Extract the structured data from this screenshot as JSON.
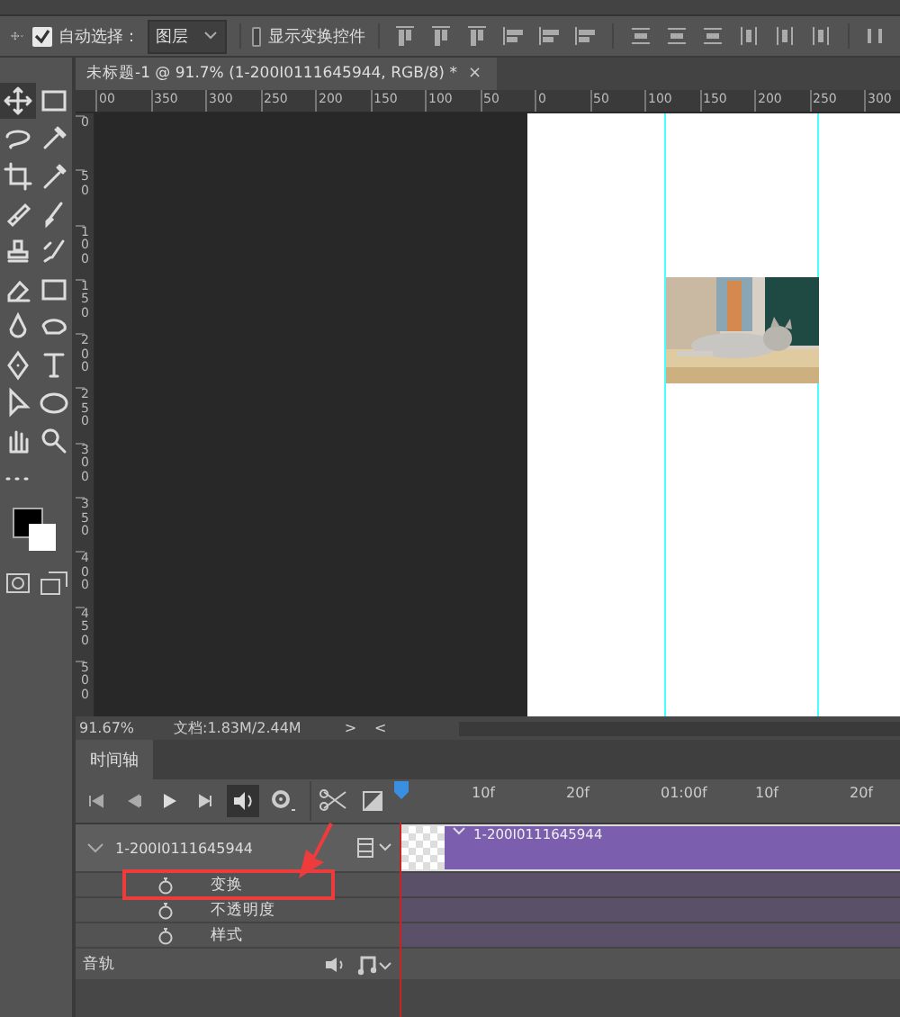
{
  "options_bar": {
    "auto_select": {
      "label": "自动选择：",
      "checked": true
    },
    "target_dropdown": {
      "value": "图层"
    },
    "show_transform_controls": {
      "label": "显示变换控件",
      "checked": false
    }
  },
  "document_tab": {
    "title": "未标题-1 @ 91.7% (1-200I0111645944, RGB/8) *",
    "close": "×"
  },
  "horizontal_ruler": [
    "00",
    "350",
    "300",
    "250",
    "200",
    "150",
    "100",
    "50",
    "0",
    "50",
    "100",
    "150",
    "200",
    "250",
    "300"
  ],
  "vertical_ruler": [
    "0",
    "50",
    "100",
    "150",
    "200",
    "250",
    "300",
    "350",
    "400",
    "450",
    "500"
  ],
  "status_bar": {
    "zoom": "91.67%",
    "document": "文档:1.83M/2.44M",
    "next": ">",
    "prev": "<"
  },
  "timeline": {
    "tab": "时间轴",
    "sound_pressed": true,
    "time_ruler": [
      "10f",
      "20f",
      "01:00f",
      "10f",
      "20f"
    ],
    "layer": {
      "name": "1-200I0111645944",
      "expanded": true,
      "clip_label": "1-200I0111645944"
    },
    "properties": [
      "变换",
      "不透明度",
      "样式"
    ],
    "audio_track": {
      "label": "音轨"
    }
  }
}
